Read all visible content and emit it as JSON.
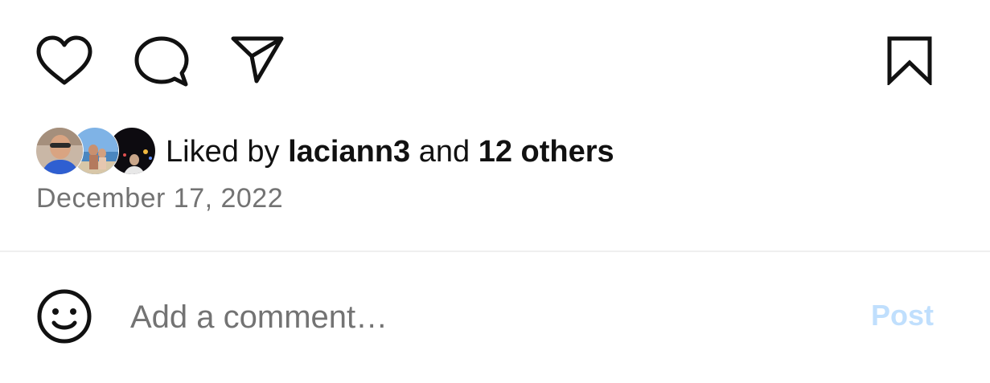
{
  "actions": {
    "like_icon": "heart-icon",
    "comment_icon": "comment-bubble-icon",
    "share_icon": "paper-plane-icon",
    "save_icon": "bookmark-icon"
  },
  "likes": {
    "prefix": "Liked by ",
    "user": "laciann3",
    "conjunction": " and ",
    "others": "12 others"
  },
  "post_date": "December 17, 2022",
  "comment_box": {
    "emoji_icon": "smiley-icon",
    "placeholder": "Add a comment…",
    "post_label": "Post"
  },
  "colors": {
    "text": "#262626",
    "secondary": "#737373",
    "post_disabled": "#c0dffd",
    "divider": "#efefef"
  }
}
